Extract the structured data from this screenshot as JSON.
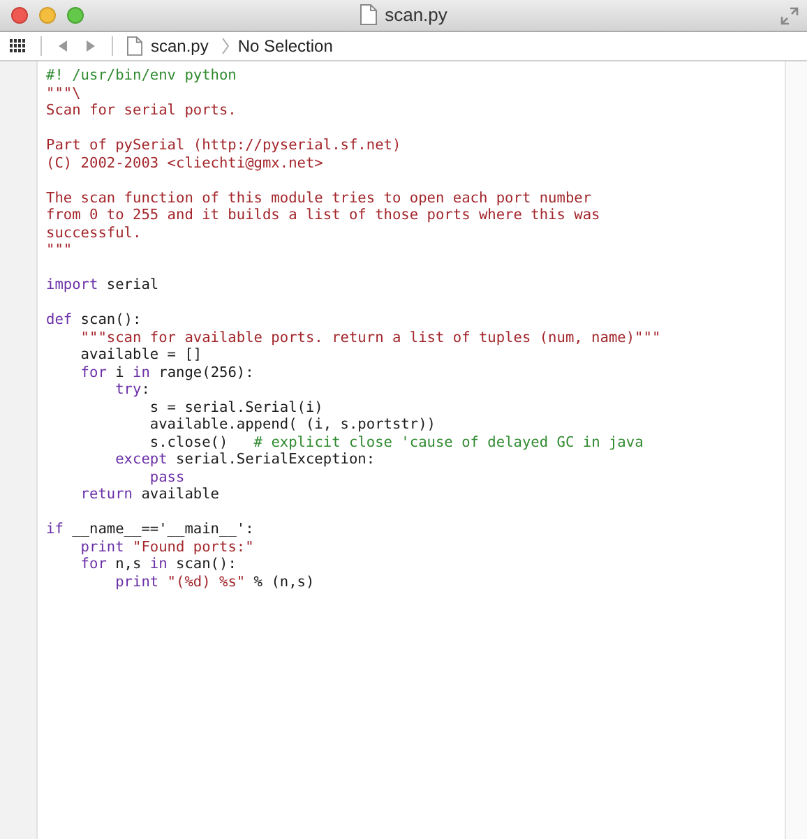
{
  "window": {
    "title": "scan.py"
  },
  "jump_bar": {
    "back_disabled": true,
    "forward_disabled": true,
    "file": "scan.py",
    "selection": "No Selection"
  },
  "code_blocks": [
    [
      [
        {
          "kind": "comment",
          "text": "#! /usr/bin/env python"
        }
      ],
      [
        {
          "kind": "string",
          "text": "\"\"\"\\"
        }
      ],
      [
        {
          "kind": "string",
          "text": "Scan for serial ports."
        }
      ]
    ],
    [
      [
        {
          "kind": "string",
          "text": "Part of pySerial (http://pyserial.sf.net)"
        }
      ],
      [
        {
          "kind": "string",
          "text": "(C) 2002-2003 <cliechti@gmx.net>"
        }
      ]
    ],
    [
      [
        {
          "kind": "string",
          "text": "The scan function of this module tries to open each port number"
        }
      ],
      [
        {
          "kind": "string",
          "text": "from 0 to 255 and it builds a list of those ports where this was"
        }
      ],
      [
        {
          "kind": "string",
          "text": "successful."
        }
      ],
      [
        {
          "kind": "string",
          "text": "\"\"\""
        }
      ]
    ],
    [
      [
        {
          "kind": "keyword",
          "text": "import"
        },
        {
          "kind": "plain",
          "text": " serial"
        }
      ]
    ],
    [
      [
        {
          "kind": "keyword",
          "text": "def"
        },
        {
          "kind": "plain",
          "text": " scan():"
        }
      ],
      [
        {
          "kind": "string",
          "text": "    \"\"\"scan for available ports. return a list of tuples (num, name)\"\"\""
        }
      ],
      [
        {
          "kind": "plain",
          "text": "    available = []"
        }
      ],
      [
        {
          "kind": "keyword",
          "text": "    for"
        },
        {
          "kind": "plain",
          "text": " i "
        },
        {
          "kind": "keyword",
          "text": "in"
        },
        {
          "kind": "plain",
          "text": " range(256):"
        }
      ],
      [
        {
          "kind": "keyword",
          "text": "        try"
        },
        {
          "kind": "plain",
          "text": ":"
        }
      ],
      [
        {
          "kind": "plain",
          "text": "            s = serial.Serial(i)"
        }
      ],
      [
        {
          "kind": "plain",
          "text": "            available.append( (i, s.portstr))"
        }
      ],
      [
        {
          "kind": "plain",
          "text": "            s.close()   "
        },
        {
          "kind": "comment",
          "text": "# explicit close 'cause of delayed GC in java"
        }
      ],
      [
        {
          "kind": "keyword",
          "text": "        except"
        },
        {
          "kind": "plain",
          "text": " serial.SerialException:"
        }
      ],
      [
        {
          "kind": "keyword",
          "text": "            pass"
        }
      ],
      [
        {
          "kind": "keyword",
          "text": "    return"
        },
        {
          "kind": "plain",
          "text": " available"
        }
      ]
    ],
    [
      [
        {
          "kind": "keyword",
          "text": "if"
        },
        {
          "kind": "plain",
          "text": " __name__=='__main__':"
        }
      ],
      [
        {
          "kind": "keyword",
          "text": "    print"
        },
        {
          "kind": "string",
          "text": " \"Found ports:\""
        }
      ],
      [
        {
          "kind": "keyword",
          "text": "    for"
        },
        {
          "kind": "plain",
          "text": " n,s "
        },
        {
          "kind": "keyword",
          "text": "in"
        },
        {
          "kind": "plain",
          "text": " scan():"
        }
      ],
      [
        {
          "kind": "keyword",
          "text": "        print"
        },
        {
          "kind": "string",
          "text": " \"(%d) %s\""
        },
        {
          "kind": "plain",
          "text": " % (n,s)"
        }
      ]
    ]
  ]
}
